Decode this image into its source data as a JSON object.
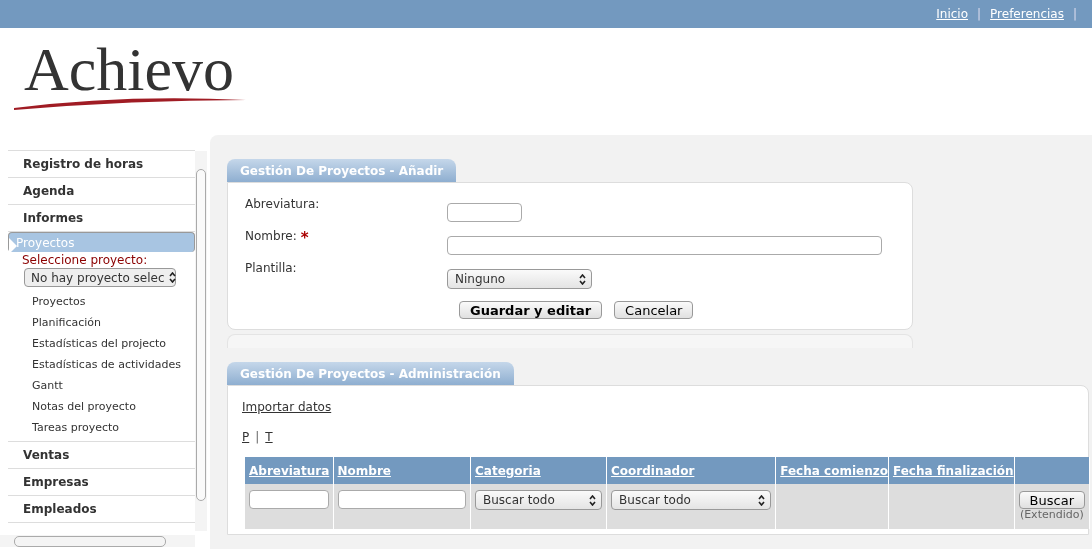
{
  "top_links": [
    "Inicio",
    "Preferencias"
  ],
  "top_separator": "|",
  "logo": {
    "text": "Achievo"
  },
  "sidebar": {
    "items": [
      {
        "label": "Registro de horas",
        "selected": false
      },
      {
        "label": "Agenda",
        "selected": false
      },
      {
        "label": "Informes",
        "selected": false
      },
      {
        "label": "Proyectos",
        "selected": true,
        "select_label": "Seleccione proyecto:",
        "select_value": "No hay proyecto selec",
        "children": [
          "Proyectos",
          "Planificación",
          "Estadísticas del projecto",
          "Estadísticas de actividades",
          "Gantt",
          "Notas del proyecto",
          "Tareas proyecto"
        ]
      },
      {
        "label": "Ventas",
        "selected": false
      },
      {
        "label": "Empresas",
        "selected": false
      },
      {
        "label": "Empleados",
        "selected": false
      }
    ]
  },
  "add_panel": {
    "title": "Gestión De Proyectos - Añadir",
    "fields": [
      {
        "label": "Abreviatura:",
        "kind": "short"
      },
      {
        "label": "Nombre:",
        "kind": "long",
        "required_mark": "*"
      },
      {
        "label": "Plantilla:",
        "kind": "select",
        "value": "Ninguno"
      }
    ],
    "buttons": [
      "Guardar y editar",
      "Cancelar"
    ]
  },
  "admin_panel": {
    "title": "Gestión De Proyectos - Administración",
    "import_link": "Importar datos",
    "index_links": [
      "P",
      "T"
    ],
    "index_separator": "|",
    "table": {
      "columns": [
        "Abreviatura",
        "Nombre",
        "Categoria",
        "Coordinador",
        "Fecha comienzo",
        "Fecha finalización"
      ],
      "filters": [
        {
          "kind": "input"
        },
        {
          "kind": "input"
        },
        {
          "kind": "select",
          "value": "Buscar todo"
        },
        {
          "kind": "select",
          "value": "Buscar todo"
        },
        {
          "kind": "empty"
        },
        {
          "kind": "empty"
        }
      ],
      "search_button": "Buscar",
      "extended_link": "(Extendido)"
    }
  }
}
